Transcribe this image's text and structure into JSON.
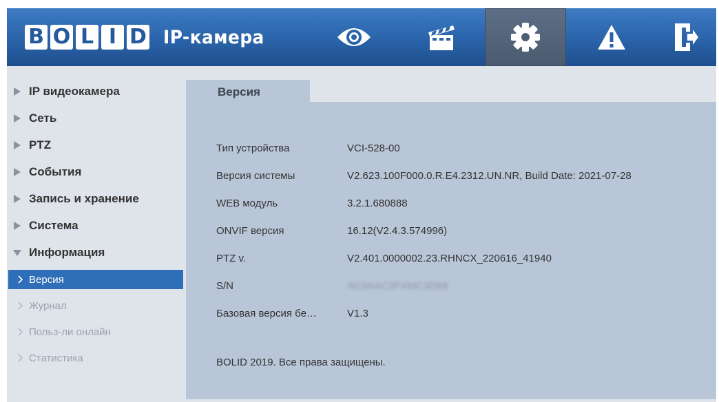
{
  "header": {
    "logo_text": "BOLID",
    "app_title": "IP-камера",
    "nav": [
      {
        "name": "live",
        "icon": "eye-icon"
      },
      {
        "name": "playback",
        "icon": "clapperboard-icon"
      },
      {
        "name": "setup",
        "icon": "gear-icon",
        "active": true
      },
      {
        "name": "alarm",
        "icon": "warning-icon"
      },
      {
        "name": "logout",
        "icon": "logout-icon"
      }
    ]
  },
  "sidebar": {
    "items": [
      {
        "label": "IP видеокамера"
      },
      {
        "label": "Сеть"
      },
      {
        "label": "PTZ"
      },
      {
        "label": "События"
      },
      {
        "label": "Запись и хранение"
      },
      {
        "label": "Система"
      },
      {
        "label": "Информация",
        "expanded": true
      }
    ],
    "sub_items": [
      {
        "label": "Версия",
        "active": true
      },
      {
        "label": "Журнал"
      },
      {
        "label": "Польз-ли онлайн"
      },
      {
        "label": "Статистика"
      }
    ]
  },
  "content": {
    "tab": "Версия",
    "rows": [
      {
        "label": "Тип устройства",
        "value": "VCI-528-00"
      },
      {
        "label": "Версия системы",
        "value": "V2.623.100F000.0.R.E4.2312.UN.NR, Build Date: 2021-07-28"
      },
      {
        "label": "WEB модуль",
        "value": "3.2.1.680888"
      },
      {
        "label": "ONVIF версия",
        "value": "16.12(V2.4.3.574996)"
      },
      {
        "label": "PTZ v.",
        "value": "V2.401.0000002.23.RHNCX_220616_41940"
      },
      {
        "label": "S/N",
        "value": "AC0AAC2FXMC3D98"
      },
      {
        "label": "Базовая версия бе…",
        "value": "V1.3"
      }
    ],
    "copyright": "BOLID 2019. Все права защищены."
  },
  "colors": {
    "header_blue": "#2a63a9",
    "active_nav": "#4e5f74",
    "sidebar_bg": "#dfe3ea",
    "content_bg": "#b9c6d8",
    "selected_item": "#2f6eb8"
  }
}
